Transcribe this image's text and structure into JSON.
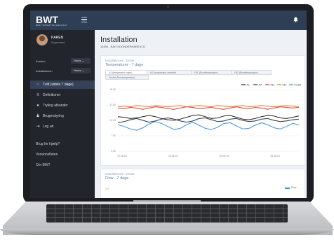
{
  "app": {
    "logo": "BWT",
    "logo_sub": "BEST WATER TECHNOLOGY"
  },
  "user": {
    "name": "KAREN",
    "role": "Supervisor"
  },
  "filters": [
    {
      "label": "Kunden",
      "value": "Hunts"
    },
    {
      "label": "Installationen",
      "value": "Hunts"
    }
  ],
  "nav": [
    {
      "label": "Tvilt (sidste 7 dage)",
      "icon": "home-icon",
      "active": true
    },
    {
      "label": "Definitioner",
      "icon": "list-icon",
      "active": false
    },
    {
      "label": "Tryling afkander",
      "icon": "user-icon",
      "active": false
    },
    {
      "label": "Brugerstyring",
      "icon": "users-icon",
      "active": false
    },
    {
      "label": "Log ud",
      "icon": "logout-icon",
      "active": false
    }
  ],
  "links": [
    "Brug for hjælp?",
    "Versionsflaten",
    "Om BWT"
  ],
  "page": {
    "title": "Installation",
    "subtitle": "15454 - BAG SOONDERHAREN 31"
  },
  "card1": {
    "label": "Installationen: 15456",
    "title": "Temperaturer - 7 dage",
    "tabs": [
      "A1 (temperatur højre)",
      "A2 (temperatur venstre)",
      "Flt1 (Rumtemperatur)",
      "Flt2 (Rumtemperatur)",
      "Fosfat (Rumtemperatur)"
    ],
    "selected_tab": 0
  },
  "card2": {
    "label": "Installationen: 15456",
    "title": "Flow - 7 dage",
    "y_tick": "1.0",
    "legend": "Flow"
  },
  "chart_data": {
    "type": "line",
    "ylim": [
      5,
      15
    ],
    "y_ticks": [
      "15.00",
      "12.50",
      "10.00",
      "7.50",
      "5.00"
    ],
    "x_ticks": [
      "22.08.16",
      "24.08.16",
      "26.08.16",
      "28.08.16"
    ],
    "series": [
      {
        "name": "A1",
        "color": "#1f2326",
        "values": [
          10.6,
          10.5,
          10.3,
          10.4,
          10.6,
          10.8,
          10.6,
          10.3,
          10.1,
          10.0,
          10.2,
          10.5,
          10.8,
          10.9,
          10.6,
          10.3,
          10.4,
          10.7,
          10.8,
          10.5,
          10.2,
          10.1,
          10.3,
          10.6,
          10.8,
          10.7,
          10.4,
          10.3,
          10.5,
          10.7
        ]
      },
      {
        "name": "A2",
        "color": "#2e3338",
        "values": [
          9.6,
          9.8,
          10.1,
          10.3,
          10.0,
          9.7,
          9.9,
          10.2,
          10.4,
          10.2,
          9.9,
          9.7,
          9.9,
          10.3,
          10.4,
          10.1,
          9.8,
          9.9,
          10.2,
          10.3,
          10.0,
          9.8,
          9.9,
          10.2,
          10.3,
          10.0,
          9.8,
          9.9,
          10.1,
          10.2
        ]
      },
      {
        "name": "Flt1",
        "color": "#d33b34",
        "values": [
          12.0,
          11.9,
          12.1,
          12.0,
          11.8,
          12.0,
          12.2,
          12.1,
          11.9,
          11.8,
          12.0,
          12.2,
          12.1,
          11.9,
          12.0,
          12.1,
          11.9,
          11.8,
          12.0,
          12.2,
          12.0,
          11.9,
          12.1,
          12.0,
          11.8,
          12.0,
          12.2,
          12.1,
          12.0,
          12.1
        ]
      },
      {
        "name": "Flt2",
        "color": "#e07a28",
        "values": [
          12.2,
          12.3,
          12.2,
          12.4,
          12.3,
          12.2,
          12.4,
          12.3,
          12.2,
          12.3,
          12.4,
          12.2,
          12.3,
          12.4,
          12.3,
          12.2,
          12.4,
          12.3,
          12.2,
          12.3,
          12.4,
          12.2,
          12.3,
          12.4,
          12.3,
          12.2,
          12.3,
          12.4,
          12.3,
          12.2
        ]
      },
      {
        "name": "Fosfat",
        "color": "#3a8fd8",
        "values": [
          9.3,
          9.0,
          8.6,
          8.4,
          8.8,
          9.4,
          9.8,
          9.5,
          9.0,
          8.5,
          8.7,
          9.3,
          9.7,
          9.2,
          8.7,
          8.5,
          8.9,
          9.5,
          9.6,
          9.1,
          8.6,
          8.7,
          9.2,
          9.6,
          9.3,
          8.8,
          8.6,
          9.0,
          9.5,
          9.3
        ]
      }
    ],
    "legend_position": "top-right",
    "grid": true
  }
}
